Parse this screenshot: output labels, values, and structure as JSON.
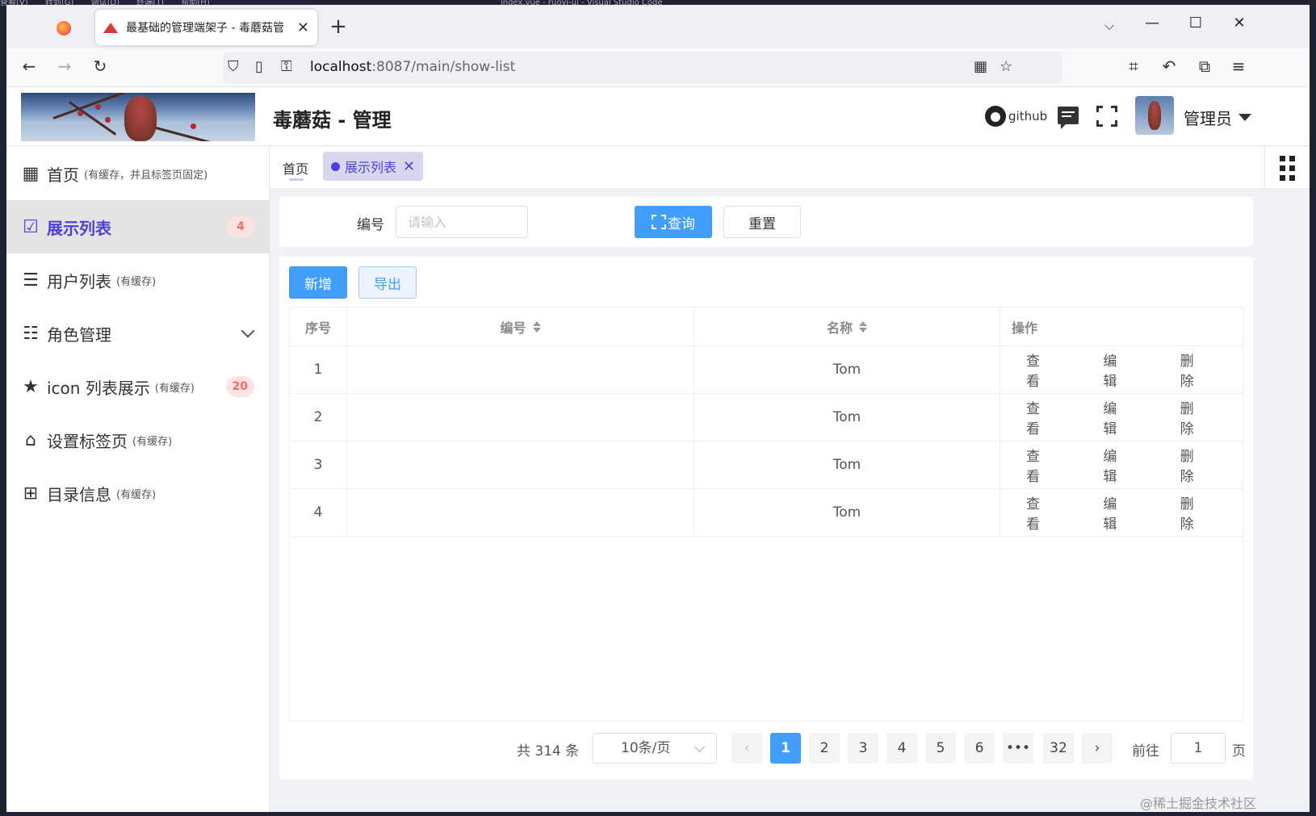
{
  "ide": {
    "menu": [
      "查看(V)",
      "转到(G)",
      "调试(D)",
      "终端(T)",
      "帮助(H)"
    ],
    "title": "index.vue - ruoyi-ui - Visual Studio Code"
  },
  "browser": {
    "tab_title": "最基础的管理端架子 - 毒蘑菇管",
    "url_host": "localhost",
    "url_rest": ":8087/main/show-list",
    "icons": [
      "firefox-logo",
      "back-arrow",
      "forward-arrow",
      "reload",
      "shield",
      "page",
      "key",
      "qr-code",
      "star",
      "crop",
      "undo",
      "extension",
      "hamburger-menu"
    ]
  },
  "header": {
    "title": "毒蘑菇 - 管理",
    "github_label": "github",
    "user_name": "管理员"
  },
  "sidebar": {
    "items": [
      {
        "label": "首页",
        "sub": "(有缓存，并且标签页固定)",
        "icon": "dashboard-icon"
      },
      {
        "label": "展示列表",
        "sub": "",
        "badge": "4",
        "icon": "monitor-check-icon",
        "active": true
      },
      {
        "label": "用户列表",
        "sub": "(有缓存)",
        "icon": "list-icon"
      },
      {
        "label": "角色管理",
        "sub": "",
        "icon": "align-left-icon",
        "has_children": true
      },
      {
        "label": "icon 列表展示",
        "sub": "(有缓存)",
        "badge": "20",
        "icon": "star-icon"
      },
      {
        "label": "设置标签页",
        "sub": "(有缓存)",
        "icon": "tag-icon"
      },
      {
        "label": "目录信息",
        "sub": "(有缓存)",
        "icon": "tree-icon"
      }
    ]
  },
  "tags": {
    "home": "首页",
    "active": "展示列表"
  },
  "search": {
    "label": "编号",
    "placeholder": "请输入",
    "query": "查询",
    "reset": "重置"
  },
  "toolbar": {
    "add": "新增",
    "export": "导出"
  },
  "table": {
    "headers": [
      "序号",
      "编号",
      "名称",
      "操作"
    ],
    "rows": [
      {
        "index": "1",
        "code": "",
        "name": "Tom"
      },
      {
        "index": "2",
        "code": "",
        "name": "Tom"
      },
      {
        "index": "3",
        "code": "",
        "name": "Tom"
      },
      {
        "index": "4",
        "code": "",
        "name": "Tom"
      }
    ],
    "ops": [
      "查看",
      "编辑",
      "删除"
    ]
  },
  "pagination": {
    "total": "共 314 条",
    "page_size": "10条/页",
    "prev": "‹",
    "next": "›",
    "pages": [
      "1",
      "2",
      "3",
      "4",
      "5",
      "6",
      "•••",
      "32"
    ],
    "current": "1",
    "goto_label": "前往",
    "goto_value": "1",
    "page_suffix": "页"
  },
  "watermark": "@稀土掘金技术社区",
  "colors": {
    "primary": "#409eff",
    "accent": "#4b3fdd",
    "badge_bg": "#fde2e2",
    "badge_text": "#f56c6c"
  }
}
